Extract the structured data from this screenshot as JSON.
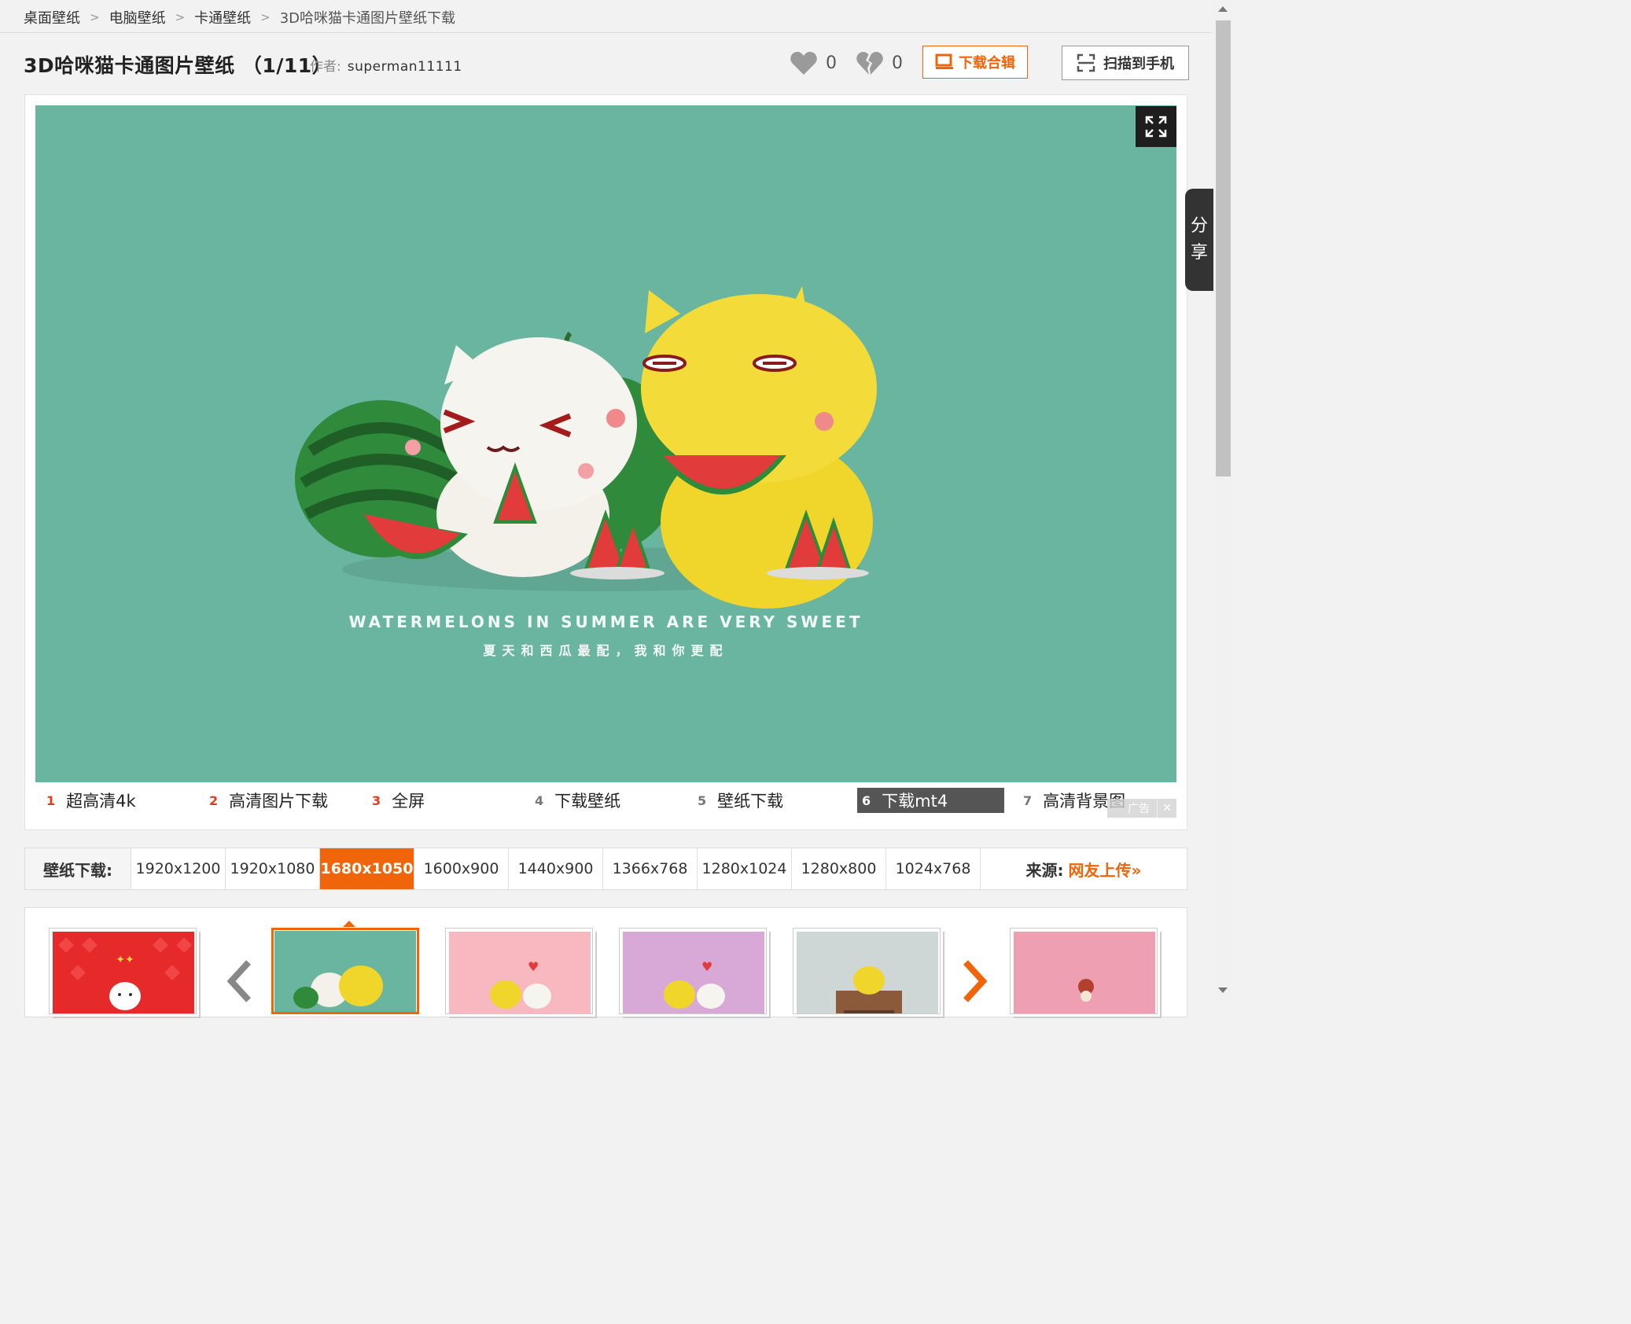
{
  "breadcrumb": [
    {
      "label": "桌面壁纸"
    },
    {
      "label": "电脑壁纸"
    },
    {
      "label": "卡通壁纸"
    },
    {
      "label": "3D哈咪猫卡通图片壁纸下载"
    }
  ],
  "header": {
    "title": "3D哈咪猫卡通图片壁纸 （1/11）",
    "author_label": "作者:",
    "author_name": "superman11111",
    "like_count": "0",
    "dislike_count": "0",
    "download_album_label": "下载合辑",
    "scan_label": "扫描到手机"
  },
  "picture": {
    "caption_en": "WATERMELONS IN SUMMER ARE VERY SWEET",
    "caption_cn": "夏天和西瓜最配，我和你更配"
  },
  "links": [
    {
      "num": "1",
      "label": "超高清4k"
    },
    {
      "num": "2",
      "label": "高清图片下载"
    },
    {
      "num": "3",
      "label": "全屏"
    },
    {
      "num": "4",
      "label": "下载壁纸"
    },
    {
      "num": "5",
      "label": "壁纸下载"
    },
    {
      "num": "6",
      "label": "下载mt4"
    },
    {
      "num": "7",
      "label": "高清背景图"
    }
  ],
  "ad_label": "广告",
  "share_label": [
    "分",
    "享"
  ],
  "resolutions": {
    "label": "壁纸下载:",
    "items": [
      "1920x1200",
      "1920x1080",
      "1680x1050",
      "1600x900",
      "1440x900",
      "1366x768",
      "1280x1024",
      "1280x800",
      "1024x768"
    ],
    "selected": "1680x1050"
  },
  "source": {
    "label": "来源:",
    "value": "网友上传»"
  },
  "colors": {
    "accent": "#f0640a",
    "picture_bg": "#69b5a0",
    "red_num": "#e03c1e"
  }
}
